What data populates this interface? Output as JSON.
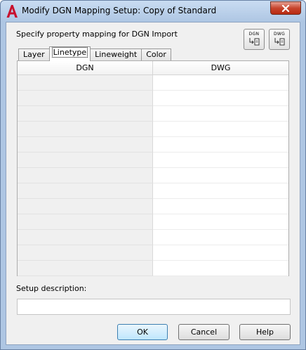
{
  "window": {
    "title": "Modify DGN Mapping Setup: Copy of Standard",
    "close_symbol": "✕"
  },
  "prompt": "Specify property mapping for DGN Import",
  "mapping_buttons": [
    {
      "label": "DGN",
      "icon": "dgn-import-icon"
    },
    {
      "label": "DWG",
      "icon": "dwg-import-icon"
    }
  ],
  "tabs": [
    {
      "label": "Layer",
      "active": false
    },
    {
      "label": "Linetype",
      "active": true
    },
    {
      "label": "Lineweight",
      "active": false
    },
    {
      "label": "Color",
      "active": false
    }
  ],
  "grid": {
    "columns": [
      "DGN",
      "DWG"
    ],
    "rows": [
      [
        "",
        ""
      ],
      [
        "",
        ""
      ],
      [
        "",
        ""
      ],
      [
        "",
        ""
      ],
      [
        "",
        ""
      ],
      [
        "",
        ""
      ],
      [
        "",
        ""
      ],
      [
        "",
        ""
      ],
      [
        "",
        ""
      ],
      [
        "",
        ""
      ],
      [
        "",
        ""
      ],
      [
        "",
        ""
      ],
      [
        "",
        ""
      ]
    ]
  },
  "setup_description": {
    "label": "Setup description:",
    "value": ""
  },
  "buttons": {
    "ok": "OK",
    "cancel": "Cancel",
    "help": "Help"
  },
  "colors": {
    "title_bar": "#aec6e3",
    "close_button": "#c7452e",
    "app_icon": "#c8102e"
  }
}
